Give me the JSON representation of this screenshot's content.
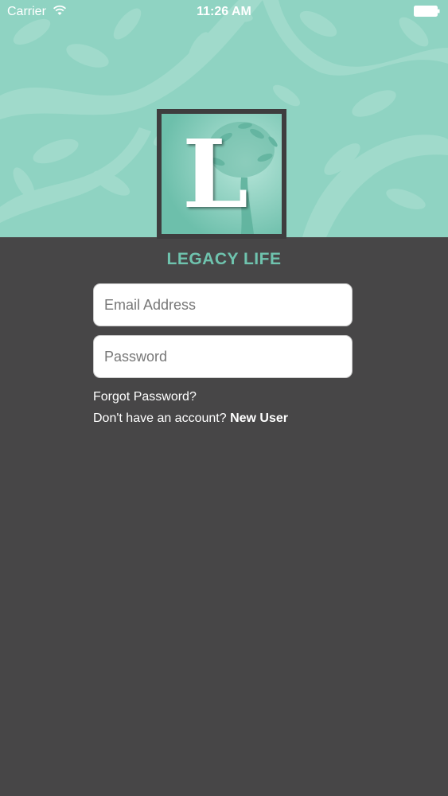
{
  "status_bar": {
    "carrier": "Carrier",
    "time": "11:26 AM"
  },
  "logo": {
    "letter": "L"
  },
  "brand": {
    "name": "LEGACY LIFE"
  },
  "form": {
    "email_placeholder": "Email Address",
    "password_placeholder": "Password",
    "email_value": "",
    "password_value": ""
  },
  "links": {
    "forgot_password": "Forgot Password?",
    "no_account": "Don't have an account?",
    "new_user": "New User"
  },
  "colors": {
    "header_teal": "#8fd3c2",
    "brand_teal": "#6fc3ae",
    "background": "#474647"
  },
  "icons": [
    "wifi-icon",
    "battery-icon",
    "tree-icon"
  ]
}
